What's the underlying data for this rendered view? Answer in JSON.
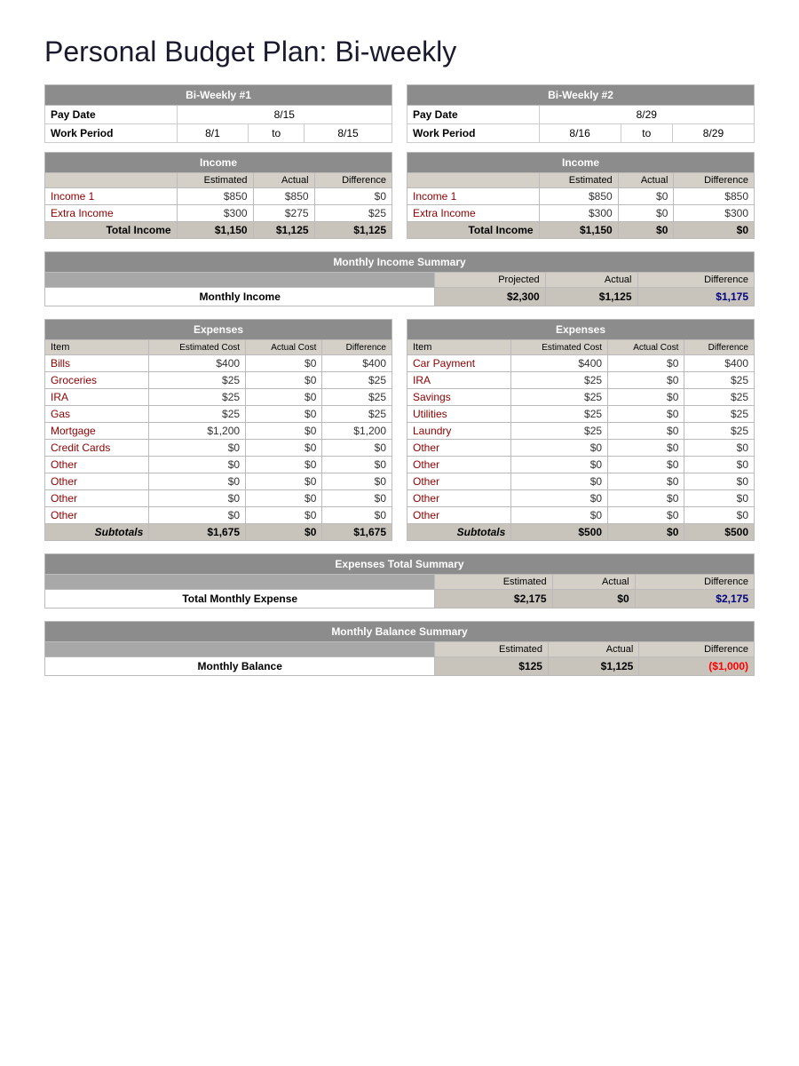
{
  "title": "Personal Budget Plan: Bi-weekly",
  "biweekly1": {
    "header": "Bi-Weekly #1",
    "payDateLabel": "Pay Date",
    "payDateValue": "8/15",
    "workPeriodLabel": "Work Period",
    "workFrom": "8/1",
    "workTo": "to",
    "workEnd": "8/15",
    "incomeHeader": "Income",
    "colEstimated": "Estimated",
    "colActual": "Actual",
    "colDifference": "Difference",
    "income1Label": "Income 1",
    "income1Est": "$850",
    "income1Act": "$850",
    "income1Diff": "$0",
    "extraLabel": "Extra Income",
    "extraEst": "$300",
    "extraAct": "$275",
    "extraDiff": "$25",
    "totalLabel": "Total Income",
    "totalEst": "$1,150",
    "totalAct": "$1,125",
    "totalDiff": "$1,125"
  },
  "biweekly2": {
    "header": "Bi-Weekly #2",
    "payDateLabel": "Pay Date",
    "payDateValue": "8/29",
    "workPeriodLabel": "Work Period",
    "workFrom": "8/16",
    "workTo": "to",
    "workEnd": "8/29",
    "incomeHeader": "Income",
    "colEstimated": "Estimated",
    "colActual": "Actual",
    "colDifference": "Difference",
    "income1Label": "Income 1",
    "income1Est": "$850",
    "income1Act": "$0",
    "income1Diff": "$850",
    "extraLabel": "Extra Income",
    "extraEst": "$300",
    "extraAct": "$0",
    "extraDiff": "$300",
    "totalLabel": "Total Income",
    "totalEst": "$1,150",
    "totalAct": "$0",
    "totalDiff": "$0"
  },
  "monthlyIncomeSummary": {
    "header": "Monthly Income Summary",
    "colProjected": "Projected",
    "colActual": "Actual",
    "colDifference": "Difference",
    "rowLabel": "Monthly Income",
    "projected": "$2,300",
    "actual": "$1,125",
    "difference": "$1,175"
  },
  "expenses1": {
    "header": "Expenses",
    "colItem": "Item",
    "colEstimated": "Estimated Cost",
    "colActual": "Actual Cost",
    "colDifference": "Difference",
    "items": [
      {
        "label": "Bills",
        "est": "$400",
        "act": "$0",
        "diff": "$400"
      },
      {
        "label": "Groceries",
        "est": "$25",
        "act": "$0",
        "diff": "$25"
      },
      {
        "label": "IRA",
        "est": "$25",
        "act": "$0",
        "diff": "$25"
      },
      {
        "label": "Gas",
        "est": "$25",
        "act": "$0",
        "diff": "$25"
      },
      {
        "label": "Mortgage",
        "est": "$1,200",
        "act": "$0",
        "diff": "$1,200"
      },
      {
        "label": "Credit Cards",
        "est": "$0",
        "act": "$0",
        "diff": "$0"
      },
      {
        "label": "Other",
        "est": "$0",
        "act": "$0",
        "diff": "$0"
      },
      {
        "label": "Other",
        "est": "$0",
        "act": "$0",
        "diff": "$0"
      },
      {
        "label": "Other",
        "est": "$0",
        "act": "$0",
        "diff": "$0"
      },
      {
        "label": "Other",
        "est": "$0",
        "act": "$0",
        "diff": "$0"
      }
    ],
    "subtotalLabel": "Subtotals",
    "subtotalEst": "$1,675",
    "subtotalAct": "$0",
    "subtotalDiff": "$1,675"
  },
  "expenses2": {
    "header": "Expenses",
    "colItem": "Item",
    "colEstimated": "Estimated Cost",
    "colActual": "Actual Cost",
    "colDifference": "Difference",
    "items": [
      {
        "label": "Car Payment",
        "est": "$400",
        "act": "$0",
        "diff": "$400"
      },
      {
        "label": "IRA",
        "est": "$25",
        "act": "$0",
        "diff": "$25"
      },
      {
        "label": "Savings",
        "est": "$25",
        "act": "$0",
        "diff": "$25"
      },
      {
        "label": "Utilities",
        "est": "$25",
        "act": "$0",
        "diff": "$25"
      },
      {
        "label": "Laundry",
        "est": "$25",
        "act": "$0",
        "diff": "$25"
      },
      {
        "label": "Other",
        "est": "$0",
        "act": "$0",
        "diff": "$0"
      },
      {
        "label": "Other",
        "est": "$0",
        "act": "$0",
        "diff": "$0"
      },
      {
        "label": "Other",
        "est": "$0",
        "act": "$0",
        "diff": "$0"
      },
      {
        "label": "Other",
        "est": "$0",
        "act": "$0",
        "diff": "$0"
      },
      {
        "label": "Other",
        "est": "$0",
        "act": "$0",
        "diff": "$0"
      }
    ],
    "subtotalLabel": "Subtotals",
    "subtotalEst": "$500",
    "subtotalAct": "$0",
    "subtotalDiff": "$500"
  },
  "expensesSummary": {
    "header": "Expenses Total Summary",
    "colEstimated": "Estimated",
    "colActual": "Actual",
    "colDifference": "Difference",
    "rowLabel": "Total Monthly Expense",
    "estimated": "$2,175",
    "actual": "$0",
    "difference": "$2,175"
  },
  "balanceSummary": {
    "header": "Monthly Balance Summary",
    "colEstimated": "Estimated",
    "colActual": "Actual",
    "colDifference": "Difference",
    "rowLabel": "Monthly Balance",
    "estimated": "$125",
    "actual": "$1,125",
    "difference": "($1,000)"
  }
}
